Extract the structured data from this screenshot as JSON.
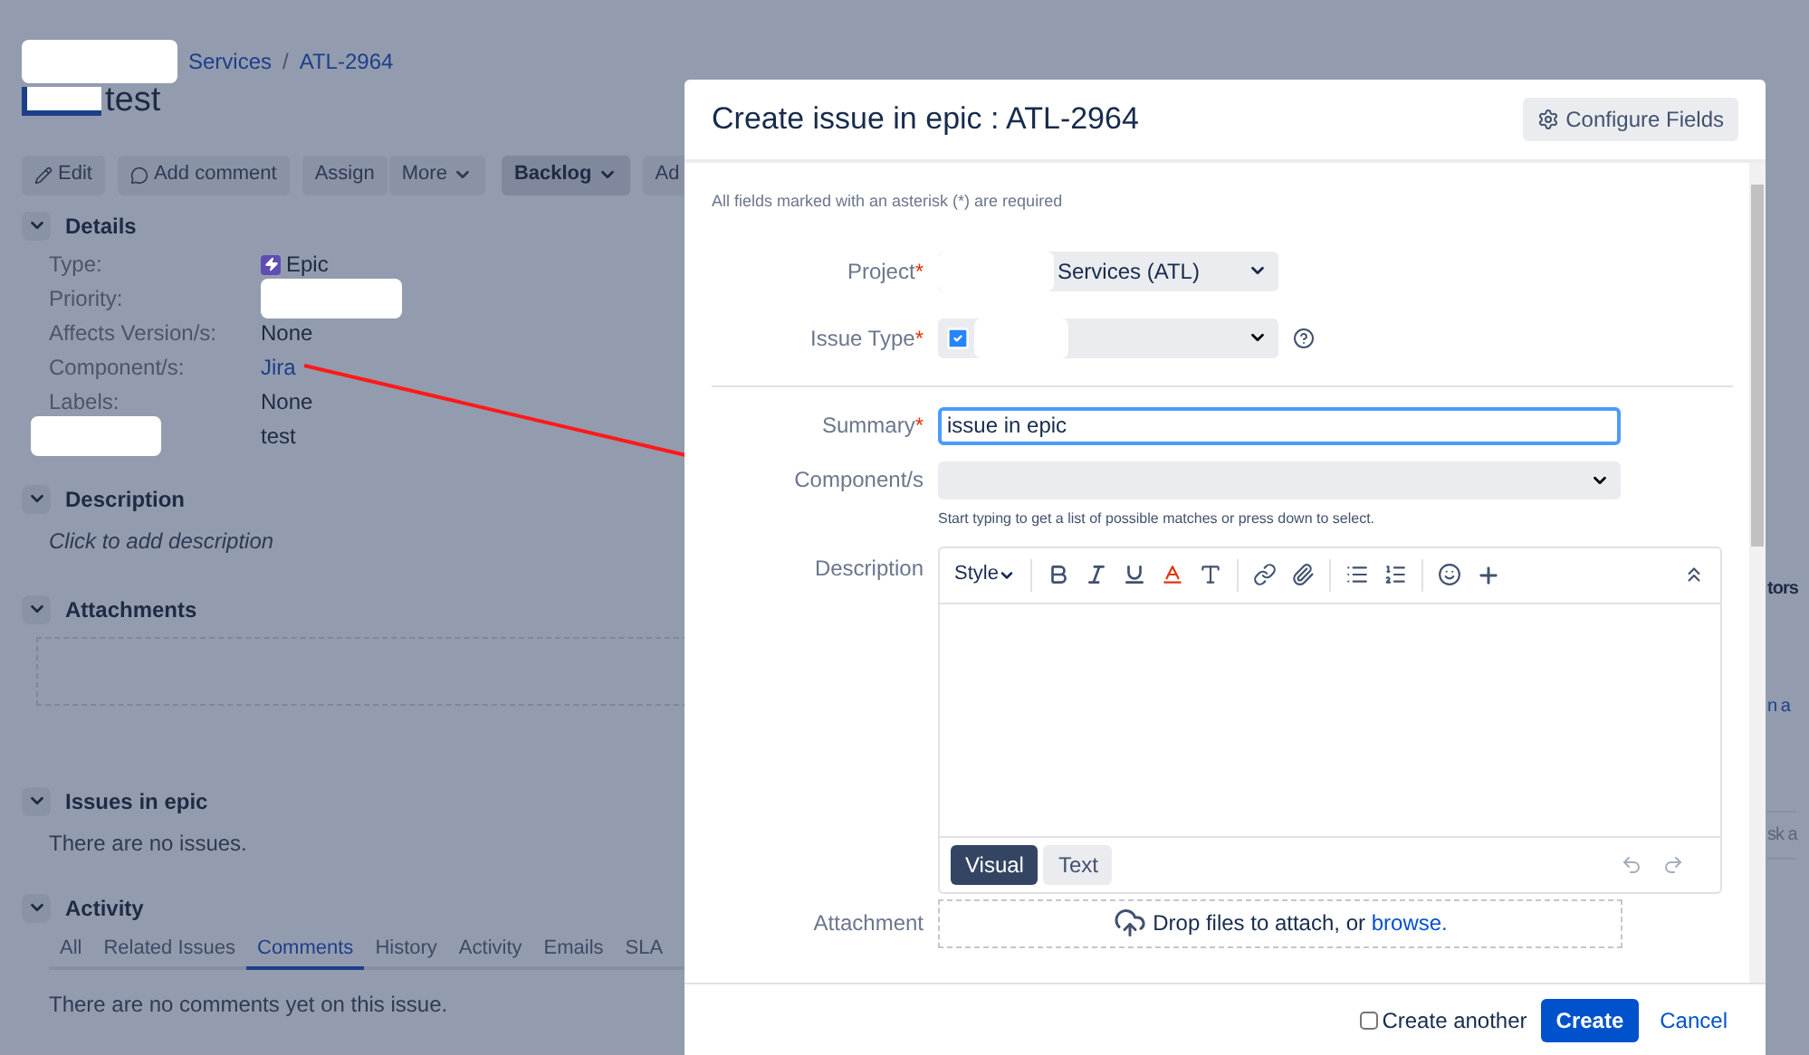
{
  "breadcrumb": [
    {
      "text": "Services"
    },
    {
      "text": "ATL-2964"
    }
  ],
  "breadcrumb_separator": "/",
  "issue_title": "test",
  "toolbar": [
    {
      "label": "Edit",
      "kind": "edit",
      "dropdown": false,
      "emphasis": false
    },
    {
      "label": "Add comment",
      "kind": "comment",
      "dropdown": false,
      "emphasis": false
    },
    {
      "label": "Assign",
      "kind": "plain",
      "dropdown": false,
      "emphasis": false
    },
    {
      "label": "More",
      "kind": "plain",
      "dropdown": true,
      "emphasis": false
    },
    {
      "label": "Backlog",
      "kind": "plain",
      "dropdown": true,
      "emphasis": true
    },
    {
      "label": "Ad",
      "kind": "plain",
      "dropdown": false,
      "emphasis": false
    }
  ],
  "details": {
    "title": "Details",
    "expanded": true,
    "rows": [
      {
        "label": "Type:",
        "value": "Epic",
        "kind": "epic"
      },
      {
        "label": "Priority:",
        "kind": "redacted-value"
      },
      {
        "label": "Affects Version/s:",
        "value": "None",
        "kind": "text"
      },
      {
        "label": "Component/s:",
        "value": "Jira",
        "kind": "link"
      },
      {
        "label": "Labels:",
        "value": "None",
        "kind": "text"
      },
      {
        "value": "test",
        "kind": "redacted-label"
      }
    ]
  },
  "description": {
    "title": "Description",
    "expanded": true,
    "placeholder": "Click to add description"
  },
  "attachments": {
    "title": "Attachments",
    "expanded": true
  },
  "issues_in_epic": {
    "title": "Issues in epic",
    "expanded": true,
    "empty_text": "There are no issues."
  },
  "activity": {
    "title": "Activity",
    "expanded": true,
    "tabs": [
      {
        "label": "All",
        "selected": false
      },
      {
        "label": "Related Issues",
        "selected": false
      },
      {
        "label": "Comments",
        "selected": true
      },
      {
        "label": "History",
        "selected": false
      },
      {
        "label": "Activity",
        "selected": false
      },
      {
        "label": "Emails",
        "selected": false
      },
      {
        "label": "SLA",
        "selected": false
      }
    ],
    "empty_text": "There are no comments yet on this issue."
  },
  "side_fragments": [
    {
      "text": "tors",
      "kind": "heading"
    },
    {
      "text": "n a",
      "kind": "link"
    },
    {
      "text": "sk a",
      "kind": "field"
    }
  ],
  "dialog": {
    "title": "Create issue in epic : ATL-2964",
    "configure_button": "Configure Fields",
    "required_note": "All fields marked with an asterisk (*) are required",
    "required_mark": "*",
    "project": {
      "label": "Project",
      "required": true,
      "value": "Services (ATL)"
    },
    "issue_type": {
      "label": "Issue Type",
      "required": true
    },
    "summary": {
      "label": "Summary",
      "required": true,
      "value": "issue in epic"
    },
    "components": {
      "label": "Component/s",
      "required": false,
      "hint": "Start typing to get a list of possible matches or press down to select."
    },
    "description": {
      "label": "Description",
      "style_menu": "Style",
      "modes": [
        {
          "label": "Visual",
          "selected": true
        },
        {
          "label": "Text",
          "selected": false
        }
      ]
    },
    "attachment": {
      "label": "Attachment",
      "text": "Drop files to attach, or",
      "link": "browse."
    },
    "create_another": {
      "label": "Create another",
      "checked": false
    },
    "create_button": "Create",
    "cancel_link": "Cancel"
  }
}
